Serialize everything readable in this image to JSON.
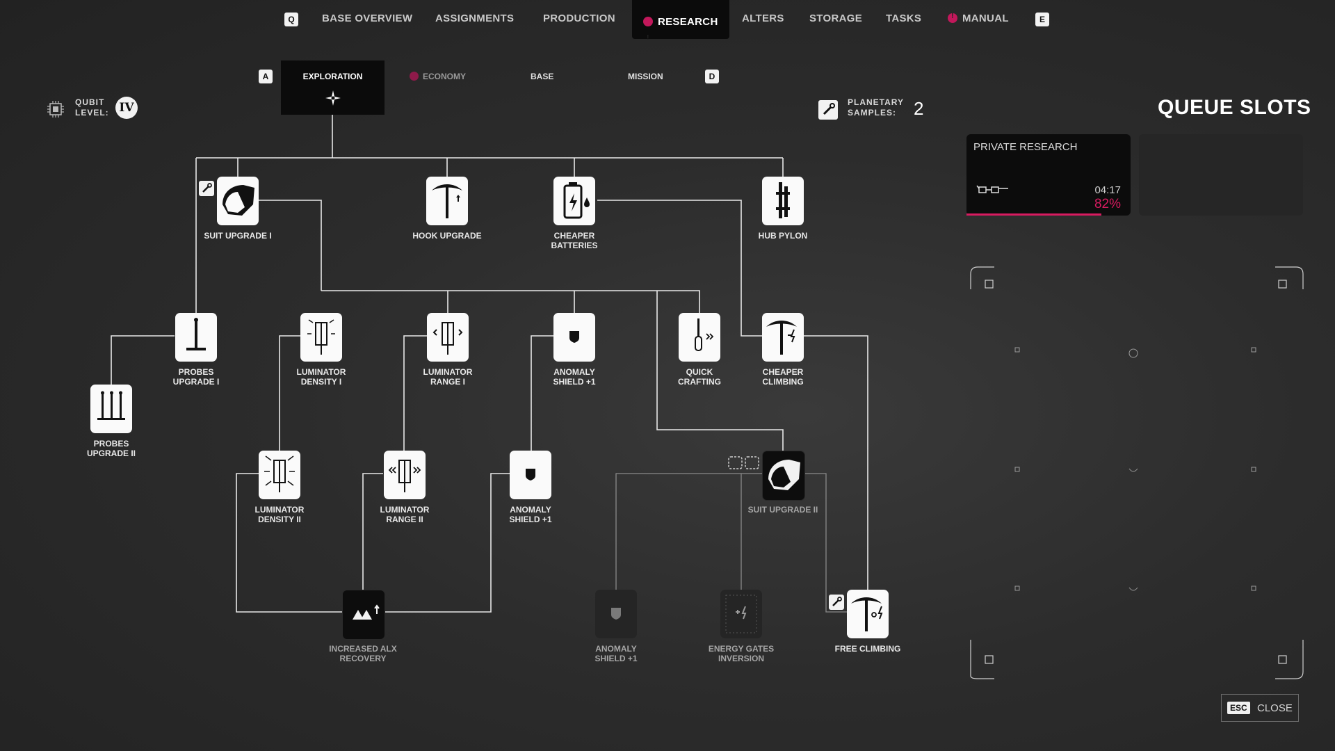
{
  "nav": {
    "q_key": "Q",
    "e_key": "E",
    "items": [
      "BASE OVERVIEW",
      "ASSIGNMENTS",
      "PRODUCTION",
      "RESEARCH",
      "ALTERS",
      "STORAGE",
      "TASKS",
      "MANUAL"
    ],
    "active": "RESEARCH"
  },
  "subtabs": {
    "a_key": "A",
    "d_key": "D",
    "items": [
      "EXPLORATION",
      "ECONOMY",
      "BASE",
      "MISSION"
    ],
    "active": "EXPLORATION"
  },
  "qubit": {
    "label_line1": "QUBIT",
    "label_line2": "LEVEL:",
    "level": "IV"
  },
  "samples": {
    "label_line1": "PLANETARY",
    "label_line2": "SAMPLES:",
    "count": "2"
  },
  "tree": {
    "suit_upgrade_1": {
      "l1": "SUIT UPGRADE I",
      "l2": ""
    },
    "hook_upgrade": {
      "l1": "HOOK UPGRADE",
      "l2": ""
    },
    "cheaper_batteries": {
      "l1": "CHEAPER",
      "l2": "BATTERIES"
    },
    "hub_pylon": {
      "l1": "HUB PYLON",
      "l2": ""
    },
    "probes_upgrade_1": {
      "l1": "PROBES",
      "l2": "UPGRADE I"
    },
    "probes_upgrade_2": {
      "l1": "PROBES",
      "l2": "UPGRADE II"
    },
    "luminator_density_1": {
      "l1": "LUMINATOR",
      "l2": "DENSITY I"
    },
    "luminator_range_1": {
      "l1": "LUMINATOR",
      "l2": "RANGE I"
    },
    "anomaly_shield_a": {
      "l1": "ANOMALY",
      "l2": "SHIELD +1"
    },
    "quick_crafting": {
      "l1": "QUICK",
      "l2": "CRAFTING"
    },
    "cheaper_climbing": {
      "l1": "CHEAPER",
      "l2": "CLIMBING"
    },
    "luminator_density_2": {
      "l1": "LUMINATOR",
      "l2": "DENSITY II"
    },
    "luminator_range_2": {
      "l1": "LUMINATOR",
      "l2": "RANGE II"
    },
    "anomaly_shield_b": {
      "l1": "ANOMALY",
      "l2": "SHIELD +1"
    },
    "suit_upgrade_2": {
      "l1": "SUIT UPGRADE II",
      "l2": ""
    },
    "increased_alx": {
      "l1": "INCREASED ALX",
      "l2": "RECOVERY"
    },
    "anomaly_shield_c": {
      "l1": "ANOMALY",
      "l2": "SHIELD +1"
    },
    "energy_gates": {
      "l1": "ENERGY GATES",
      "l2": "INVERSION"
    },
    "free_climbing": {
      "l1": "FREE CLIMBING",
      "l2": ""
    }
  },
  "queue": {
    "title": "QUEUE SLOTS",
    "slot1": {
      "title": "PRIVATE RESEARCH",
      "time": "04:17",
      "percent": "82%",
      "progress": 0.82
    }
  },
  "close": {
    "key": "ESC",
    "label": "CLOSE"
  },
  "colors": {
    "accent": "#d81b60",
    "panel": "#0c0c0c",
    "line": "#e8e8e8"
  }
}
